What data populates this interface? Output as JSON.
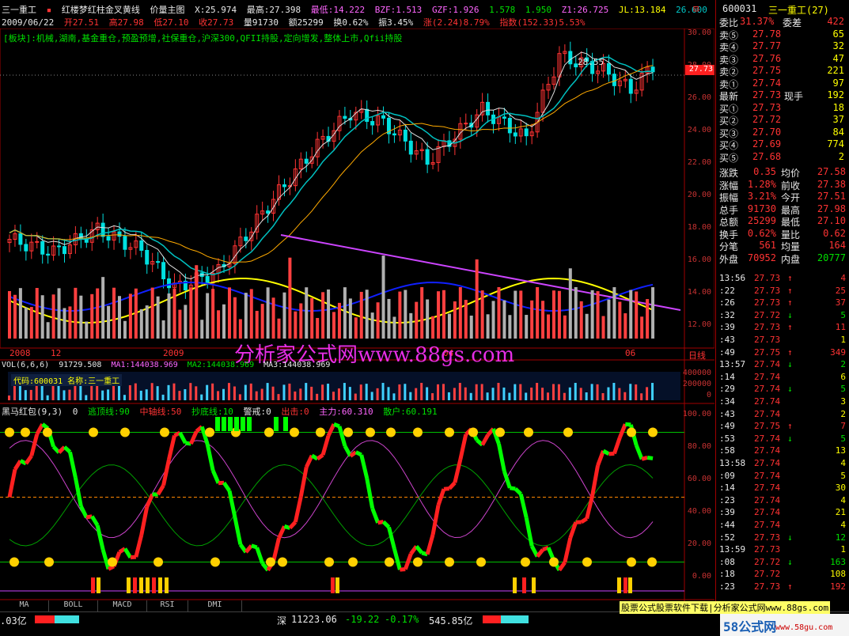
{
  "chart_header": {
    "stock_name": "三一重工",
    "indicator_name": "红楼梦红柱金叉黄线",
    "chart_mode": "价量主图",
    "x_label": "X:25.974",
    "high_label": "最高:27.398",
    "low_label": "最低:14.222",
    "bzf": "BZF:1.513",
    "gzf": "GZF:1.926",
    "v1": "1.578",
    "v2": "1.950",
    "z1": "Z1:26.725",
    "jl": "JL:13.184",
    "v3": "26.600",
    "close_btn": "⊟"
  },
  "date_line": {
    "date": "2009/06/22",
    "open": "开27.51",
    "high": "高27.98",
    "low": "低27.10",
    "close": "收27.73",
    "volume": "量91730",
    "amount": "额25299",
    "turnover": "换0.62%",
    "amplitude": "振3.45%",
    "change": "涨(2.24)8.79%",
    "index": "指数(152.33)5.53%"
  },
  "sector_line": "[板块]:机械,湖南,基金重仓,预盈预增,社保重仓,沪深300,QFII持股,定向增发,整体上市,Qfii持股",
  "price_axis": [
    "30.00",
    "28.00",
    "26.00",
    "24.00",
    "22.00",
    "20.00",
    "18.00",
    "16.00",
    "14.00",
    "12.00"
  ],
  "price_tag": "27.73",
  "annotation_peak": "28.55",
  "x_axis": [
    "2008",
    "12",
    "2009",
    "04",
    "06"
  ],
  "x_axis_right": "日线",
  "watermark": "分析家公式网www.88gs.com",
  "vol_header": {
    "label": "VOL(6,6,6)",
    "v": "91729.508",
    "ma1": "MA1:144038.969",
    "ma2": "MA2:144038.969",
    "ma3": "MA3:144038.969"
  },
  "vol_name_box": "代码:600031 名称:三一重工",
  "vol_axis": [
    "400000",
    "200000",
    "0"
  ],
  "ind_header": {
    "name": "黑马红包(9,3)",
    "v0": "0",
    "escape": "逃顶线:90",
    "axis": "中轴线:50",
    "bottom": "抄底线:10",
    "warn": "警戒:0",
    "out": "出击:0",
    "main": "主力:60.310",
    "retail": "散户:60.191"
  },
  "ind_axis": [
    "100.00",
    "80.00",
    "60.00",
    "40.00",
    "20.00",
    "0.00"
  ],
  "tabs": [
    "MA",
    "BOLL",
    "MACD",
    "RSI",
    "DMI"
  ],
  "status_bar": {
    "left": ".03亿",
    "sz_label": "深",
    "sz_index": "11223.06",
    "sz_change": "-19.22",
    "sz_pct": "-0.17%",
    "sz_amount": "545.85亿",
    "promo": "股票公式股票软件下载|分析家公式网www.88gs.com",
    "logo": "58公式网",
    "logo_url": "www.58gu.com"
  },
  "quote": {
    "code": "600031",
    "name": "三一重工(27)",
    "weibi_label": "委比",
    "weibi": "31.37%",
    "weicha_label": "委差",
    "weicha": "422",
    "asks": [
      {
        "label": "卖⑤",
        "price": "27.78",
        "vol": "65"
      },
      {
        "label": "卖④",
        "price": "27.77",
        "vol": "32"
      },
      {
        "label": "卖③",
        "price": "27.76",
        "vol": "47"
      },
      {
        "label": "卖②",
        "price": "27.75",
        "vol": "221"
      },
      {
        "label": "卖①",
        "price": "27.74",
        "vol": "97"
      }
    ],
    "last_label": "最新",
    "last": "27.73",
    "xianshou_label": "现手",
    "xianshou": "192",
    "bids": [
      {
        "label": "买①",
        "price": "27.73",
        "vol": "18"
      },
      {
        "label": "买②",
        "price": "27.72",
        "vol": "37"
      },
      {
        "label": "买③",
        "price": "27.70",
        "vol": "84"
      },
      {
        "label": "买④",
        "price": "27.69",
        "vol": "774"
      },
      {
        "label": "买⑤",
        "price": "27.68",
        "vol": "2"
      }
    ],
    "stats": [
      {
        "l1": "涨跌",
        "v1": "0.35",
        "l2": "均价",
        "v2": "27.58"
      },
      {
        "l1": "涨幅",
        "v1": "1.28%",
        "l2": "前收",
        "v2": "27.38"
      },
      {
        "l1": "振幅",
        "v1": "3.21%",
        "l2": "今开",
        "v2": "27.51"
      },
      {
        "l1": "总手",
        "v1": "91730",
        "l2": "最高",
        "v2": "27.98"
      },
      {
        "l1": "总额",
        "v1": "25299",
        "l2": "最低",
        "v2": "27.10"
      },
      {
        "l1": "换手",
        "v1": "0.62%",
        "l2": "量比",
        "v2": "0.62"
      },
      {
        "l1": "分笔",
        "v1": "561",
        "l2": "均量",
        "v2": "164"
      }
    ],
    "waipan_label": "外盘",
    "waipan": "70952",
    "neipan_label": "内盘",
    "neipan": "20777"
  },
  "ticks": [
    {
      "t": "13:56",
      "p": "27.73",
      "v": "4",
      "d": "↑"
    },
    {
      "t": ":22",
      "p": "27.73",
      "v": "25",
      "d": "↑"
    },
    {
      "t": ":26",
      "p": "27.73",
      "v": "37",
      "d": "↑"
    },
    {
      "t": ":32",
      "p": "27.72",
      "v": "5",
      "d": "↓"
    },
    {
      "t": ":39",
      "p": "27.73",
      "v": "11",
      "d": "↑"
    },
    {
      "t": ":43",
      "p": "27.73",
      "v": "1",
      "d": ""
    },
    {
      "t": ":49",
      "p": "27.75",
      "v": "349",
      "d": "↑"
    },
    {
      "t": "13:57",
      "p": "27.74",
      "v": "2",
      "d": "↓"
    },
    {
      "t": ":14",
      "p": "27.74",
      "v": "6",
      "d": ""
    },
    {
      "t": ":29",
      "p": "27.74",
      "v": "5",
      "d": "↓"
    },
    {
      "t": ":34",
      "p": "27.74",
      "v": "3",
      "d": ""
    },
    {
      "t": ":43",
      "p": "27.74",
      "v": "2",
      "d": ""
    },
    {
      "t": ":49",
      "p": "27.75",
      "v": "7",
      "d": "↑"
    },
    {
      "t": ":53",
      "p": "27.74",
      "v": "5",
      "d": "↓"
    },
    {
      "t": ":58",
      "p": "27.74",
      "v": "13",
      "d": ""
    },
    {
      "t": "13:58",
      "p": "27.74",
      "v": "4",
      "d": ""
    },
    {
      "t": ":09",
      "p": "27.74",
      "v": "5",
      "d": ""
    },
    {
      "t": ":14",
      "p": "27.74",
      "v": "30",
      "d": ""
    },
    {
      "t": ":23",
      "p": "27.74",
      "v": "4",
      "d": ""
    },
    {
      "t": ":39",
      "p": "27.74",
      "v": "21",
      "d": ""
    },
    {
      "t": ":44",
      "p": "27.74",
      "v": "4",
      "d": ""
    },
    {
      "t": ":52",
      "p": "27.73",
      "v": "12",
      "d": "↓"
    },
    {
      "t": "13:59",
      "p": "27.73",
      "v": "1",
      "d": ""
    },
    {
      "t": ":08",
      "p": "27.72",
      "v": "163",
      "d": "↓"
    },
    {
      "t": ":18",
      "p": "27.72",
      "v": "108",
      "d": ""
    },
    {
      "t": ":23",
      "p": "27.73",
      "v": "192",
      "d": "↑"
    }
  ],
  "colors": {
    "up": "#ff3333",
    "down": "#00e0e0",
    "ma_yellow": "#ffff00",
    "ma_blue": "#1020ff",
    "trendline": "#cc44ff"
  }
}
